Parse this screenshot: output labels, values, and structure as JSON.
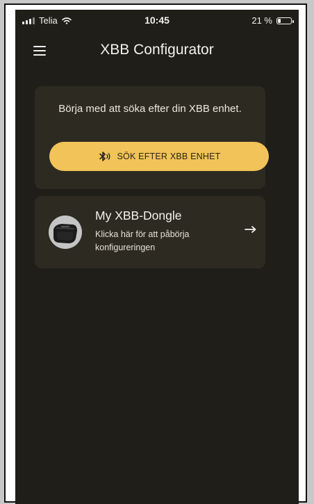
{
  "status_bar": {
    "carrier": "Telia",
    "time": "10:45",
    "battery_percent": "21 %",
    "battery_level": 0.21
  },
  "header": {
    "title": "XBB Configurator",
    "menu_icon": "hamburger-menu-icon"
  },
  "search_card": {
    "instruction": "Börja med att söka efter din XBB enhet.",
    "button_label": "SÖK EFTER XBB ENHET",
    "button_icon": "bluetooth-icon",
    "button_color": "#f1c359"
  },
  "device_card": {
    "name": "My XBB-Dongle",
    "subtitle": "Klicka här för att påbörja konfigureringen",
    "image": "xbb-dongle-image",
    "arrow_icon": "arrow-right-icon"
  },
  "colors": {
    "background": "#201e19",
    "card": "#2d2a22",
    "accent": "#f1c359",
    "text": "#f4f2ec"
  }
}
